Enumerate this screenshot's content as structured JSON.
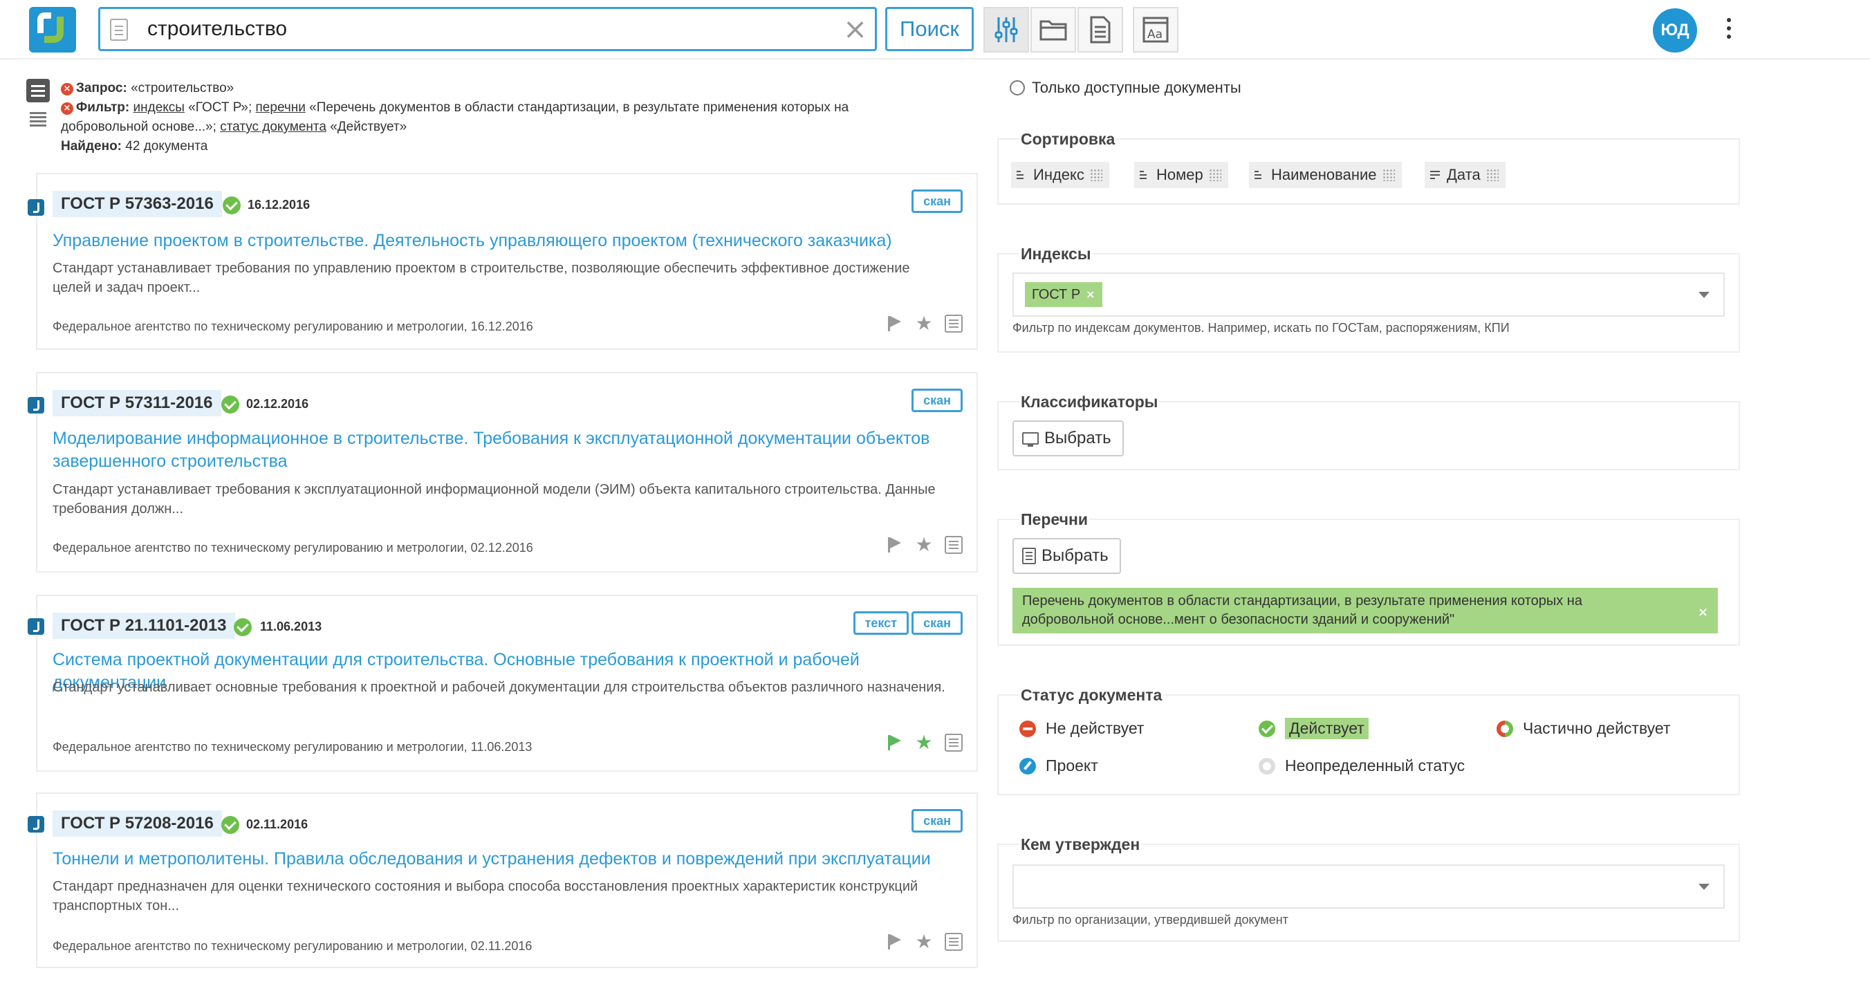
{
  "header": {
    "search_value": "строительство",
    "search_button": "Поиск",
    "avatar_initials": "ЮД"
  },
  "query": {
    "request_label": "Запрос:",
    "request_value": "«строительство»",
    "filter_label": "Фильтр:",
    "filter_indexes_link": "индексы",
    "filter_indexes_value": "«ГОСТ Р»;",
    "filter_lists_link": "перечни",
    "filter_lists_value": "«Перечень документов в области стандартизации, в результате применения которых на добровольной основе...»;",
    "filter_status_link": "статус документа",
    "filter_status_value": "«Действует»",
    "found_label": "Найдено:",
    "found_value": "42 документа"
  },
  "results": [
    {
      "code": "ГОСТ Р 57363-2016",
      "date": "16.12.2016",
      "tags": [
        "скан"
      ],
      "title": "Управление проектом в строительстве. Деятельность управляющего проектом (технического заказчика)",
      "description": "Стандарт устанавливает требования по управлению проектом в строительстве, позволяющие обеспечить эффективное достижение целей и задач проект...",
      "source": "Федеральное агентство по техническому регулированию и метрологии, 16.12.2016",
      "flagged": false,
      "starred": false
    },
    {
      "code": "ГОСТ Р 57311-2016",
      "date": "02.12.2016",
      "tags": [
        "скан"
      ],
      "title": "Моделирование информационное в строительстве. Требования к эксплуатационной документации объектов завершенного строительства",
      "description": "Стандарт устанавливает требования к эксплуатационной информационной модели (ЭИМ) объекта капитального строительства. Данные требования должн...",
      "source": "Федеральное агентство по техническому регулированию и метрологии, 02.12.2016",
      "flagged": false,
      "starred": false
    },
    {
      "code": "ГОСТ Р 21.1101-2013",
      "date": "11.06.2013",
      "tags": [
        "текст",
        "скан"
      ],
      "title": "Система проектной документации для строительства. Основные требования к проектной и рабочей документации",
      "description": "Стандарт устанавливает основные требования к проектной и рабочей документации для строительства объектов различного назначения.",
      "source": "Федеральное агентство по техническому регулированию и метрологии, 11.06.2013",
      "flagged": true,
      "starred": true
    },
    {
      "code": "ГОСТ Р 57208-2016",
      "date": "02.11.2016",
      "tags": [
        "скан"
      ],
      "title": "Тоннели и метрополитены. Правила обследования и устранения дефектов и повреждений при эксплуатации",
      "description": "Стандарт предназначен для оценки технического состояния и выбора способа восстановления проектных характеристик конструкций транспортных тон...",
      "source": "Федеральное агентство по техническому регулированию и метрологии, 02.11.2016",
      "flagged": false,
      "starred": false
    }
  ],
  "filters": {
    "available_only": "Только доступные документы",
    "sort": {
      "title": "Сортировка",
      "options": [
        "Индекс",
        "Номер",
        "Наименование",
        "Дата"
      ]
    },
    "indexes": {
      "title": "Индексы",
      "selected": "ГОСТ Р",
      "hint": "Фильтр по индексам документов. Например, искать по ГОСТам, распоряжениям, КПИ"
    },
    "classifiers": {
      "title": "Классификаторы",
      "button": "Выбрать"
    },
    "lists": {
      "title": "Перечни",
      "button": "Выбрать",
      "selected": "Перечень документов в области стандартизации, в результате применения которых на добровольной основе...мент о безопасности зданий и сооружений\""
    },
    "status": {
      "title": "Статус документа",
      "inactive": "Не действует",
      "active": "Действует",
      "partial": "Частично действует",
      "project": "Проект",
      "unknown": "Неопределенный статус"
    },
    "approved_by": {
      "title": "Кем утвержден",
      "hint": "Фильтр по организации, утвердившей документ"
    }
  },
  "colors": {
    "accent": "#2196d3",
    "link": "#2a9ad8",
    "success": "#6cc04a",
    "chip": "#a5d685",
    "danger": "#e04a2f"
  }
}
